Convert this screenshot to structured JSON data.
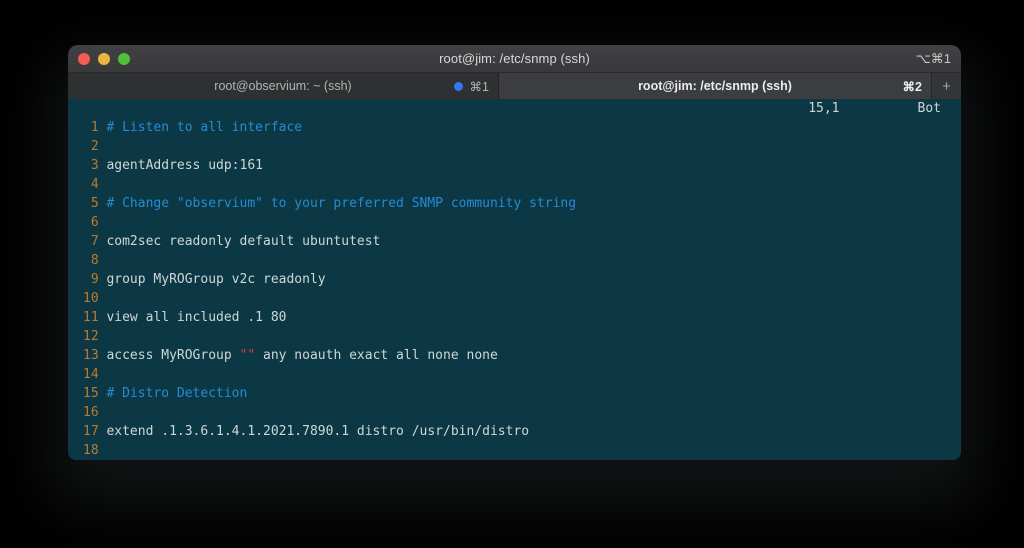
{
  "window": {
    "title": "root@jim: /etc/snmp (ssh)",
    "shortcut": "⌥⌘1"
  },
  "tabs": [
    {
      "label": "root@observium: ~ (ssh)",
      "shortcut": "⌘1",
      "active": false,
      "activity_dot": true
    },
    {
      "label": "root@jim: /etc/snmp (ssh)",
      "shortcut": "⌘2",
      "active": true,
      "activity_dot": false
    }
  ],
  "new_tab_label": "+",
  "ruler": {
    "position": "15,1",
    "scroll_state": "Bot"
  },
  "editor": {
    "filetype": "snmpd.conf (vim)",
    "lines": [
      {
        "num": "1",
        "segments": [
          {
            "type": "comment",
            "text": "# Listen to all interface"
          }
        ]
      },
      {
        "num": "2",
        "segments": []
      },
      {
        "num": "3",
        "segments": [
          {
            "type": "default",
            "text": "agentAddress udp:161"
          }
        ]
      },
      {
        "num": "4",
        "segments": []
      },
      {
        "num": "5",
        "segments": [
          {
            "type": "comment",
            "text": "# Change \"observium\" to your preferred SNMP community string"
          }
        ]
      },
      {
        "num": "6",
        "segments": []
      },
      {
        "num": "7",
        "segments": [
          {
            "type": "default",
            "text": "com2sec readonly default ubuntutest"
          }
        ]
      },
      {
        "num": "8",
        "segments": []
      },
      {
        "num": "9",
        "segments": [
          {
            "type": "default",
            "text": "group MyROGroup v2c readonly"
          }
        ]
      },
      {
        "num": "10",
        "segments": []
      },
      {
        "num": "11",
        "segments": [
          {
            "type": "default",
            "text": "view all included .1 80"
          }
        ]
      },
      {
        "num": "12",
        "segments": []
      },
      {
        "num": "13",
        "segments": [
          {
            "type": "default",
            "text": "access MyROGroup "
          },
          {
            "type": "string",
            "text": "\"\""
          },
          {
            "type": "default",
            "text": " any noauth exact all none none"
          }
        ]
      },
      {
        "num": "14",
        "segments": []
      },
      {
        "num": "15",
        "segments": [
          {
            "type": "comment",
            "text": "# Distro Detection"
          }
        ]
      },
      {
        "num": "16",
        "segments": []
      },
      {
        "num": "17",
        "segments": [
          {
            "type": "default",
            "text": "extend .1.3.6.1.4.1.2021.7890.1 distro /usr/bin/distro"
          }
        ]
      },
      {
        "num": "18",
        "segments": []
      }
    ]
  },
  "colors": {
    "terminal_bg": "#0c3845",
    "text": "#cdd7d5",
    "comment": "#268bd2",
    "line_number": "#bb7a2d",
    "string": "#d63c35",
    "titlebar_bg": "#39393b",
    "titlebar_top": "#414143",
    "tab_inactive_bg": "#2f3032",
    "tab_active_bg": "#3c3d3f",
    "activity_dot": "#3a76f0",
    "traffic_red": "#f25d54",
    "traffic_yellow": "#eab73e",
    "traffic_green": "#4fc03c"
  }
}
